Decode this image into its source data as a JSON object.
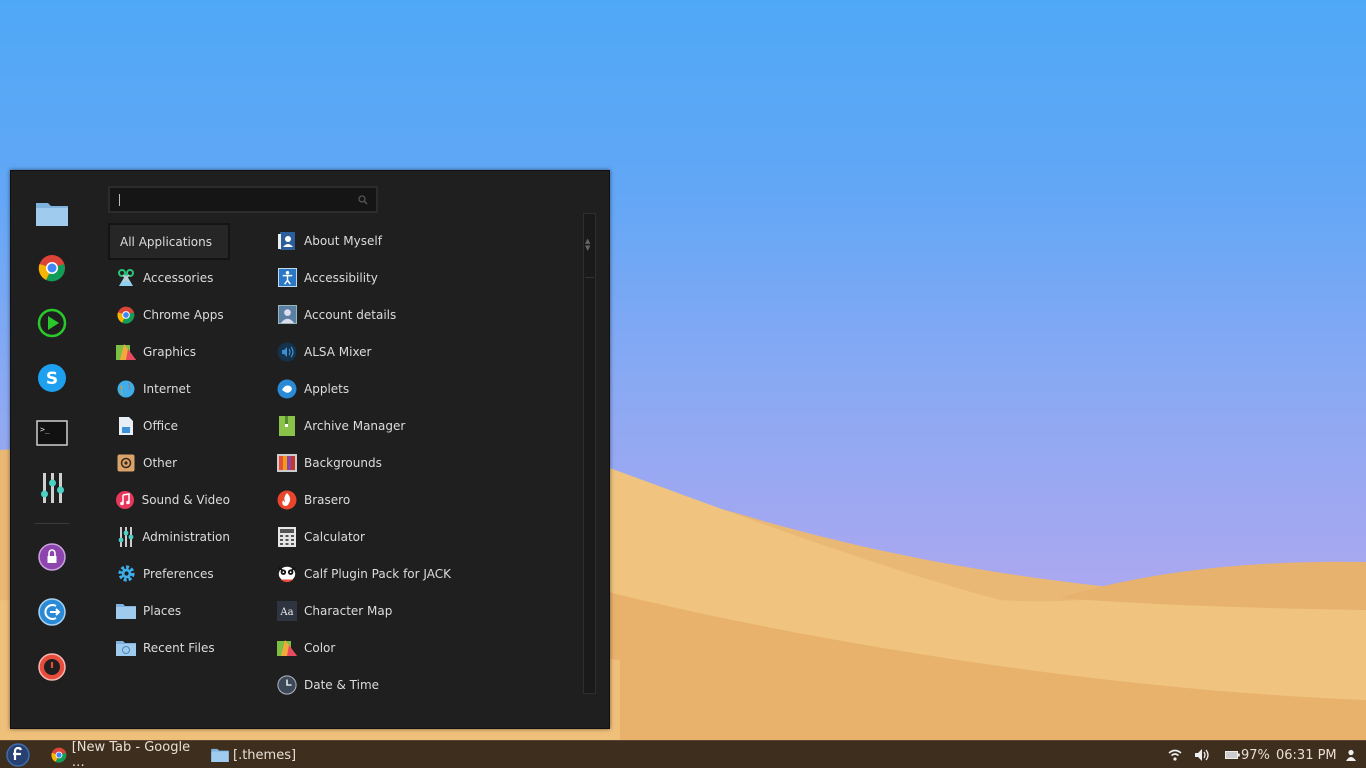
{
  "search": {
    "placeholder": "",
    "value": ""
  },
  "favorites": [
    {
      "name": "Files",
      "icon": "folder-icon"
    },
    {
      "name": "Google Chrome",
      "icon": "chrome-icon"
    },
    {
      "name": "Media Player",
      "icon": "play-icon"
    },
    {
      "name": "Skype",
      "icon": "skype-icon"
    },
    {
      "name": "Terminal",
      "icon": "terminal-icon"
    },
    {
      "name": "Settings",
      "icon": "sliders-icon"
    },
    {
      "name": "Lock Screen",
      "icon": "lock-icon"
    },
    {
      "name": "Log Out",
      "icon": "logout-icon"
    },
    {
      "name": "Shut Down",
      "icon": "power-icon"
    }
  ],
  "categories": [
    {
      "label": "All Applications",
      "selected": true
    },
    {
      "label": "Accessories",
      "icon": "accessories-icon"
    },
    {
      "label": "Chrome Apps",
      "icon": "chrome-icon"
    },
    {
      "label": "Graphics",
      "icon": "graphics-icon"
    },
    {
      "label": "Internet",
      "icon": "internet-icon"
    },
    {
      "label": "Office",
      "icon": "office-icon"
    },
    {
      "label": "Other",
      "icon": "other-icon"
    },
    {
      "label": "Sound & Video",
      "icon": "music-icon"
    },
    {
      "label": "Administration",
      "icon": "administration-icon"
    },
    {
      "label": "Preferences",
      "icon": "gear-icon"
    },
    {
      "label": "Places",
      "icon": "folder-icon"
    },
    {
      "label": "Recent Files",
      "icon": "recent-files-icon"
    }
  ],
  "apps": [
    {
      "label": "About Myself",
      "icon": "about-myself-icon"
    },
    {
      "label": "Accessibility",
      "icon": "accessibility-icon"
    },
    {
      "label": "Account details",
      "icon": "account-icon"
    },
    {
      "label": "ALSA Mixer",
      "icon": "mixer-icon"
    },
    {
      "label": "Applets",
      "icon": "applets-icon"
    },
    {
      "label": "Archive Manager",
      "icon": "archive-icon"
    },
    {
      "label": "Backgrounds",
      "icon": "backgrounds-icon"
    },
    {
      "label": "Brasero",
      "icon": "brasero-icon"
    },
    {
      "label": "Calculator",
      "icon": "calculator-icon"
    },
    {
      "label": "Calf Plugin Pack for JACK",
      "icon": "calf-icon"
    },
    {
      "label": "Character Map",
      "icon": "character-map-icon"
    },
    {
      "label": "Color",
      "icon": "color-icon"
    },
    {
      "label": "Date & Time",
      "icon": "clock-icon"
    }
  ],
  "taskbar": {
    "tasks": [
      {
        "label": "[New Tab - Google …",
        "icon": "chrome-icon"
      },
      {
        "label": "[.themes]",
        "icon": "folder-icon"
      }
    ],
    "battery": "97%",
    "clock": "06:31 PM"
  },
  "colors": {
    "menu_bg": "#1f1f1f",
    "taskbar_bg": "#3e2e1e",
    "sky_top": "#4fa8f6",
    "sand": "#efc27c"
  }
}
